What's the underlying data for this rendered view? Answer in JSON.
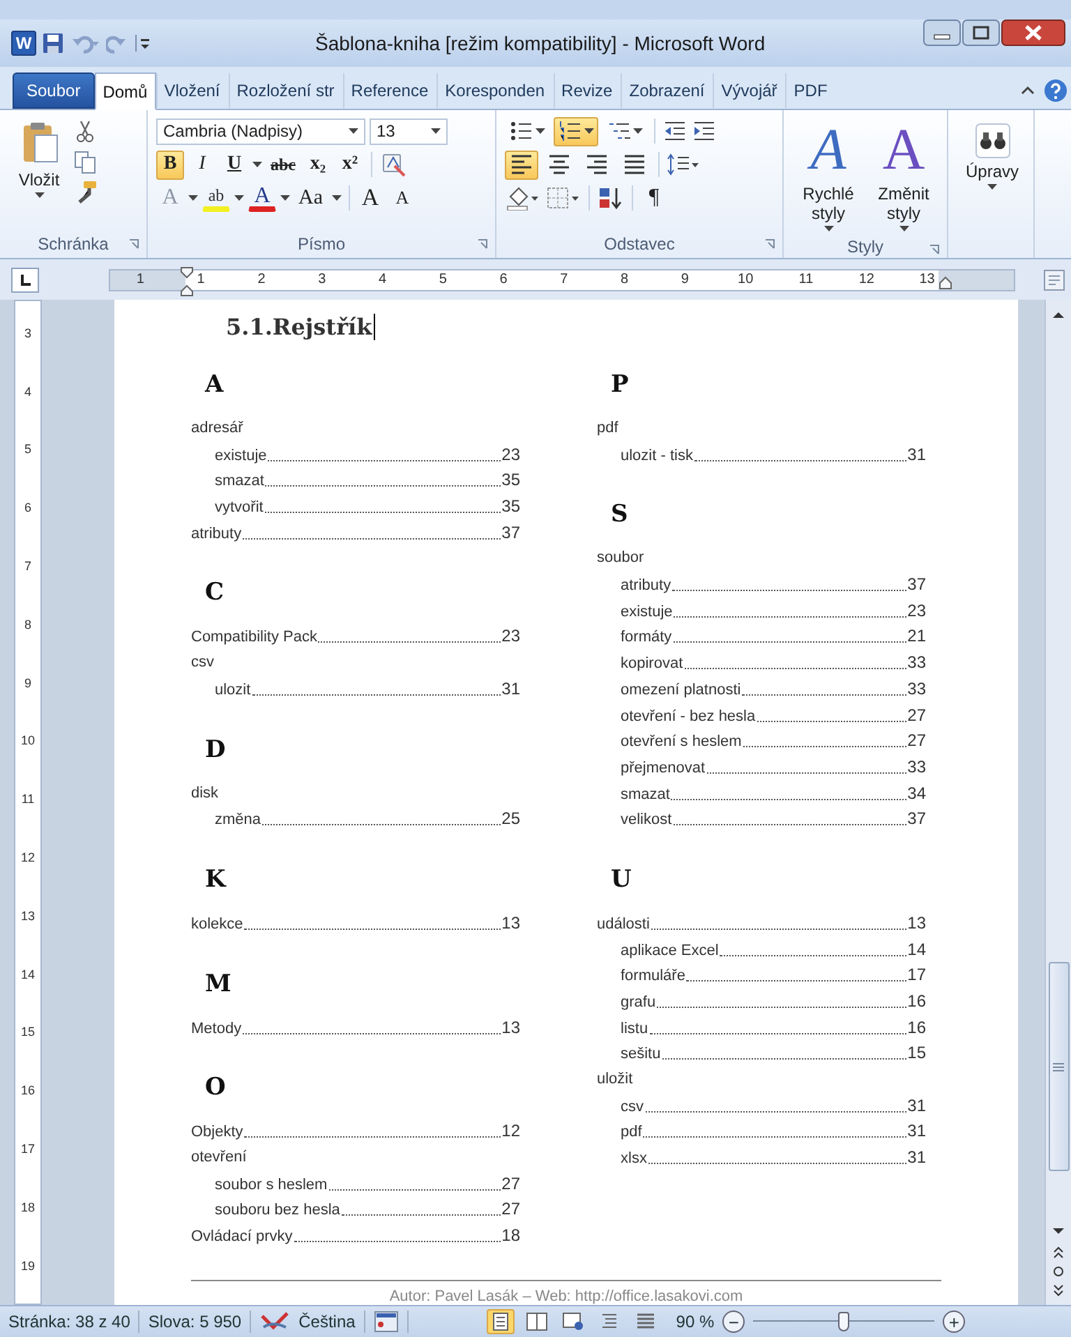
{
  "window": {
    "app_icon": "W",
    "title": "Šablona-kniha [režim kompatibility] - Microsoft Word"
  },
  "ribbon_tabs": [
    {
      "label": "Soubor",
      "kind": "file",
      "selected": false
    },
    {
      "label": "Domů",
      "kind": "tab",
      "selected": true
    },
    {
      "label": "Vložení",
      "kind": "tab",
      "selected": false
    },
    {
      "label": "Rozložení str",
      "kind": "tab",
      "selected": false
    },
    {
      "label": "Reference",
      "kind": "tab",
      "selected": false
    },
    {
      "label": "Koresponden",
      "kind": "tab",
      "selected": false
    },
    {
      "label": "Revize",
      "kind": "tab",
      "selected": false
    },
    {
      "label": "Zobrazení",
      "kind": "tab",
      "selected": false
    },
    {
      "label": "Vývojář",
      "kind": "tab",
      "selected": false
    },
    {
      "label": "PDF",
      "kind": "tab",
      "selected": false
    }
  ],
  "clipboard": {
    "paste": "Vložit",
    "label": "Schránka"
  },
  "font": {
    "name": "Cambria (Nadpisy)",
    "size": "13",
    "label": "Písmo",
    "format_buttons": [
      {
        "label": "B",
        "kind": "bold",
        "on": true
      },
      {
        "label": "I",
        "kind": "italic",
        "on": false
      },
      {
        "label": "U",
        "kind": "underline",
        "on": false
      },
      {
        "label": "abc",
        "kind": "strike",
        "on": false
      },
      {
        "label": "x₂",
        "kind": "sub",
        "on": false
      },
      {
        "label": "x²",
        "kind": "sup",
        "on": false
      }
    ],
    "tools": [
      {
        "label": "A",
        "kind": "effects"
      },
      {
        "label": "ab",
        "kind": "highlight"
      },
      {
        "label": "A",
        "kind": "color"
      },
      {
        "label": "Aa",
        "kind": "case"
      },
      {
        "label": "A",
        "kind": "grow"
      },
      {
        "label": "A",
        "kind": "shrink"
      }
    ]
  },
  "paragraph": {
    "label": "Odstavec",
    "show_marks": "¶",
    "list_buttons": [
      {
        "kind": "bullets",
        "selected": false
      },
      {
        "kind": "numbering",
        "selected": true
      },
      {
        "kind": "multilevel",
        "selected": false
      }
    ],
    "align_buttons": [
      {
        "kind": "left",
        "selected": true
      },
      {
        "kind": "center",
        "selected": false
      },
      {
        "kind": "right",
        "selected": false
      },
      {
        "kind": "justify",
        "selected": false
      }
    ]
  },
  "styles": {
    "label": "Styly",
    "buttons": [
      {
        "glyph": "A",
        "kind": "quick",
        "label": "Rychlé styly"
      },
      {
        "glyph": "A",
        "kind": "change",
        "label": "Změnit styly"
      }
    ]
  },
  "editing": {
    "label": "Úpravy"
  },
  "ruler": {
    "labels": [
      "1",
      "1",
      "2",
      "3",
      "4",
      "5",
      "6",
      "7",
      "8",
      "9",
      "10",
      "11",
      "12",
      "13"
    ]
  },
  "vertical_ruler": {
    "labels": [
      "3",
      "4",
      "5",
      "6",
      "7",
      "8",
      "9",
      "10",
      "11",
      "12",
      "13",
      "14",
      "15",
      "16",
      "17",
      "18",
      "19"
    ]
  },
  "document": {
    "heading": "5.1.Rejstřík",
    "columns": [
      [
        {
          "letter": "A",
          "entries": [
            {
              "text": "adresář",
              "children": [
                {
                  "text": "existuje",
                  "page": "23"
                },
                {
                  "text": "smazat",
                  "page": "35"
                },
                {
                  "text": "vytvořit",
                  "page": "35"
                }
              ]
            },
            {
              "text": "atributy",
              "page": "37"
            }
          ]
        },
        {
          "letter": "C",
          "entries": [
            {
              "text": "Compatibility Pack",
              "page": "23"
            },
            {
              "text": "csv",
              "children": [
                {
                  "text": "ulozit",
                  "page": "31"
                }
              ]
            }
          ]
        },
        {
          "letter": "D",
          "entries": [
            {
              "text": "disk",
              "children": [
                {
                  "text": "změna",
                  "page": "25"
                }
              ]
            }
          ]
        },
        {
          "letter": "K",
          "entries": [
            {
              "text": "kolekce",
              "page": "13"
            }
          ]
        },
        {
          "letter": "M",
          "entries": [
            {
              "text": "Metody",
              "page": "13"
            }
          ]
        },
        {
          "letter": "O",
          "entries": [
            {
              "text": "Objekty",
              "page": "12"
            },
            {
              "text": "otevření",
              "children": [
                {
                  "text": "soubor s heslem",
                  "page": "27"
                },
                {
                  "text": "souboru bez hesla",
                  "page": "27"
                }
              ]
            },
            {
              "text": "Ovládací prvky",
              "page": "18"
            }
          ]
        }
      ],
      [
        {
          "letter": "P",
          "entries": [
            {
              "text": "pdf",
              "children": [
                {
                  "text": "ulozit - tisk",
                  "page": "31"
                }
              ]
            }
          ]
        },
        {
          "letter": "S",
          "entries": [
            {
              "text": "soubor",
              "children": [
                {
                  "text": "atributy",
                  "page": "37"
                },
                {
                  "text": "existuje",
                  "page": "23"
                },
                {
                  "text": "formáty",
                  "page": "21"
                },
                {
                  "text": "kopirovat",
                  "page": "33"
                },
                {
                  "text": "omezení platnosti",
                  "page": "33"
                },
                {
                  "text": "otevření - bez hesla",
                  "page": "27"
                },
                {
                  "text": "otevření s heslem",
                  "page": "27"
                },
                {
                  "text": "přejmenovat",
                  "page": "33"
                },
                {
                  "text": "smazat",
                  "page": "34"
                },
                {
                  "text": "velikost",
                  "page": "37"
                }
              ]
            }
          ]
        },
        {
          "letter": "U",
          "entries": [
            {
              "text": "události",
              "page": "13",
              "children": [
                {
                  "text": "aplikace Excel",
                  "page": "14"
                },
                {
                  "text": "formuláře",
                  "page": "17"
                },
                {
                  "text": "grafu",
                  "page": "16"
                },
                {
                  "text": "listu",
                  "page": "16"
                },
                {
                  "text": "sešitu",
                  "page": "15"
                }
              ]
            },
            {
              "text": "uložit",
              "children": [
                {
                  "text": "csv",
                  "page": "31"
                },
                {
                  "text": "pdf",
                  "page": "31"
                },
                {
                  "text": "xlsx",
                  "page": "31"
                }
              ]
            }
          ]
        }
      ]
    ],
    "footer": "Autor: Pavel Lasák – Web: http://office.lasakovi.com"
  },
  "status_bar": {
    "page": "Stránka: 38 z 40",
    "words": "Slova: 5 950",
    "language": "Čeština",
    "views": [
      {
        "selected": true
      },
      {
        "selected": false
      },
      {
        "selected": false
      },
      {
        "selected": false
      },
      {
        "selected": false
      }
    ],
    "zoom": "90 %",
    "zoom_out": "−",
    "zoom_in": "+",
    "zoom_slider": {
      "level": 0.5
    }
  }
}
